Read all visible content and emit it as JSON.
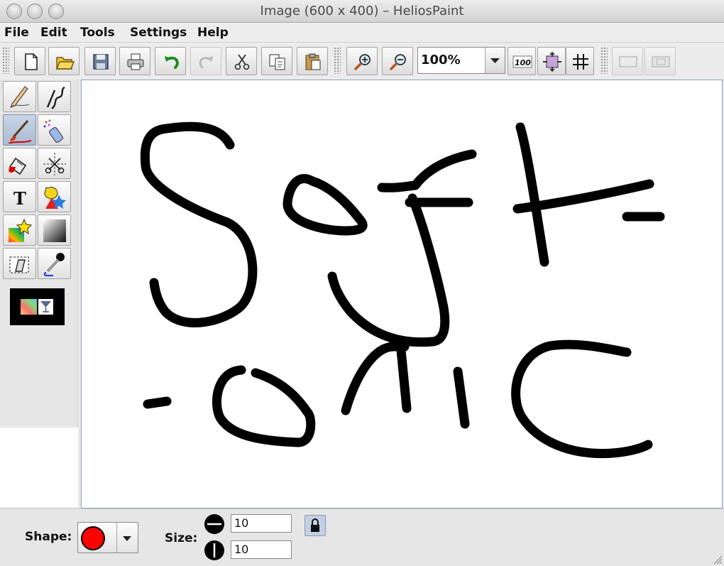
{
  "window": {
    "title": "Image (600 x 400) – HeliosPaint"
  },
  "menu": [
    "File",
    "Edit",
    "Tools",
    "Settings",
    "Help"
  ],
  "toolbar": {
    "buttons": [
      "new-file",
      "open-file",
      "save",
      "print",
      "undo",
      "redo",
      "cut",
      "copy",
      "paste",
      "zoom-in",
      "zoom-out"
    ],
    "zoom": "100%",
    "extra_buttons": [
      "actual-size",
      "fit-window",
      "grid",
      "show-selection",
      "crop"
    ]
  },
  "tools": [
    "pencil",
    "line",
    "brush",
    "spray",
    "fill",
    "select-cut",
    "text",
    "shapes",
    "effects",
    "gradient",
    "stamp",
    "color-picker"
  ],
  "text_tool_glyph": "T",
  "bottom": {
    "shape_label": "Shape:",
    "shape_color": "#ff0000",
    "size_label": "Size:",
    "width": "10",
    "height": "10"
  }
}
